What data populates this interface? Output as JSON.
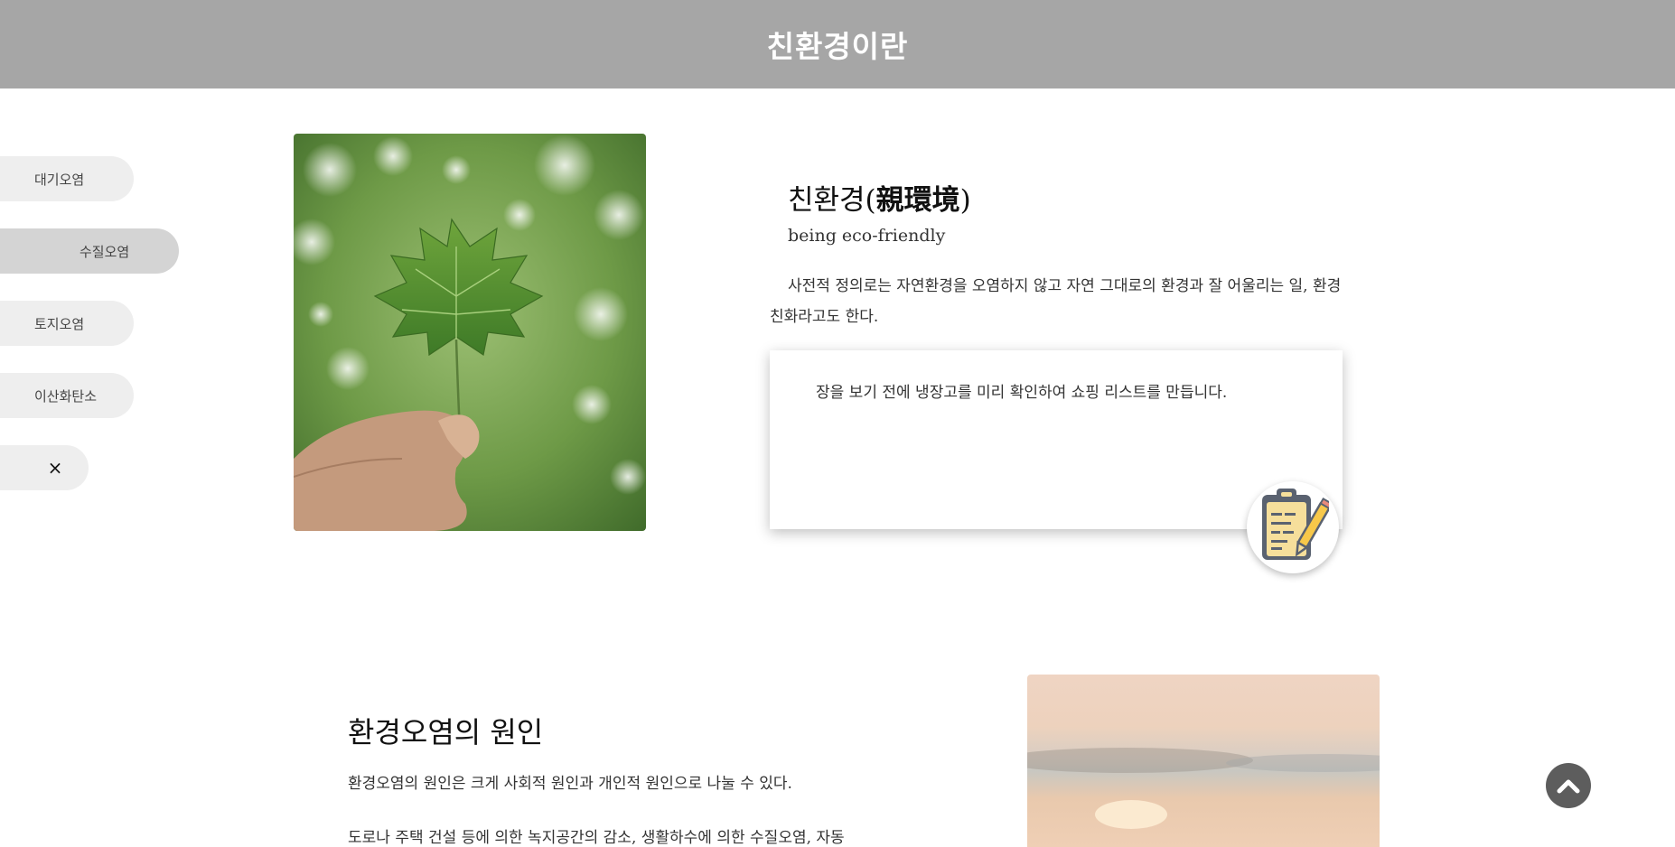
{
  "header": {
    "title": "친환경이란"
  },
  "sidebar": {
    "items": [
      {
        "label": "대기오염"
      },
      {
        "label": "수질오염"
      },
      {
        "label": "토지오염"
      },
      {
        "label": "이산화탄소"
      }
    ],
    "close_label": "×"
  },
  "intro": {
    "title_prefix": "친환경(",
    "title_hanja": "親環境",
    "title_suffix": ")",
    "subtitle": "being eco-friendly",
    "definition": "사전적 정의로는 자연환경을 오염하지 않고 자연 그대로의 환경과 잘 어울리는 일, 환경친화라고도 한다.",
    "tip": "장을 보기 전에 냉장고를 미리 확인하여 쇼핑 리스트를 만듭니다."
  },
  "causes": {
    "title": "환경오염의 원인",
    "paragraph1": "환경오염의 원인은 크게 사회적 원인과 개인적 원인으로 나눌 수 있다.",
    "paragraph2": "도로나 주택 건설 등에 의한 녹지공간의 감소, 생활하수에 의한 수질오염, 자동"
  },
  "icons": {
    "clipboard": "clipboard-pencil-icon",
    "scroll_top": "chevron-up-icon",
    "close": "close-icon"
  }
}
